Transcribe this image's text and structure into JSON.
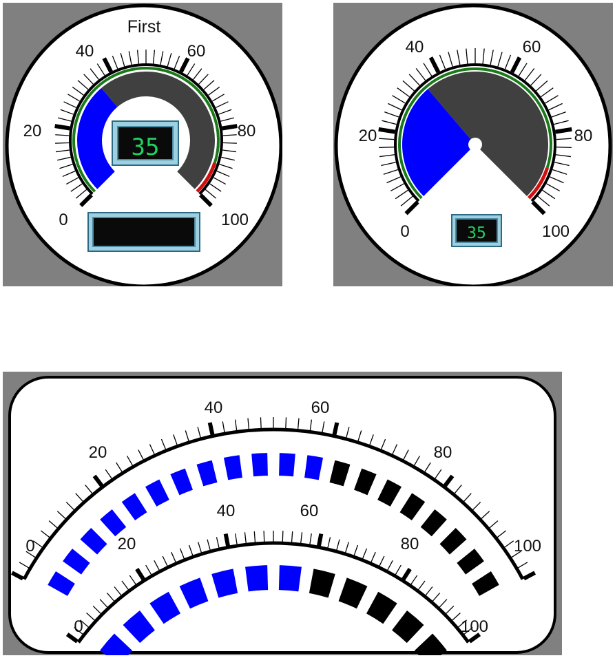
{
  "gauge1": {
    "title": "First",
    "value": 35,
    "readout": "35",
    "min": 0,
    "max": 100,
    "labels": [
      "0",
      "20",
      "40",
      "60",
      "80",
      "100"
    ],
    "fill_color": "#0000ff",
    "track_color": "#404040",
    "normal_band_color": "#1a7a1a",
    "alarm_band_color": "#d01010",
    "secondary_display": ""
  },
  "gauge2": {
    "value": 35,
    "readout": "35",
    "min": 0,
    "max": 100,
    "labels": [
      "0",
      "20",
      "40",
      "60",
      "80",
      "100"
    ],
    "fill_color": "#0000ff",
    "track_color": "#404040",
    "normal_band_color": "#1a7a1a",
    "alarm_band_color": "#d01010"
  },
  "gauge3": {
    "outer": {
      "value": 60,
      "min": 0,
      "max": 100,
      "labels": [
        "0",
        "20",
        "40",
        "60",
        "80",
        "100"
      ]
    },
    "inner": {
      "value": 60,
      "min": 0,
      "max": 100,
      "labels": [
        "0",
        "20",
        "40",
        "60",
        "80",
        "100"
      ]
    },
    "active_color": "#0000ff",
    "inactive_color": "#000000"
  },
  "colors": {
    "panel_background": "#808080",
    "face": "#ffffff",
    "bezel": "#000000",
    "lcd_background": "#0a0a0a",
    "lcd_frame": "#5a9ab5"
  }
}
